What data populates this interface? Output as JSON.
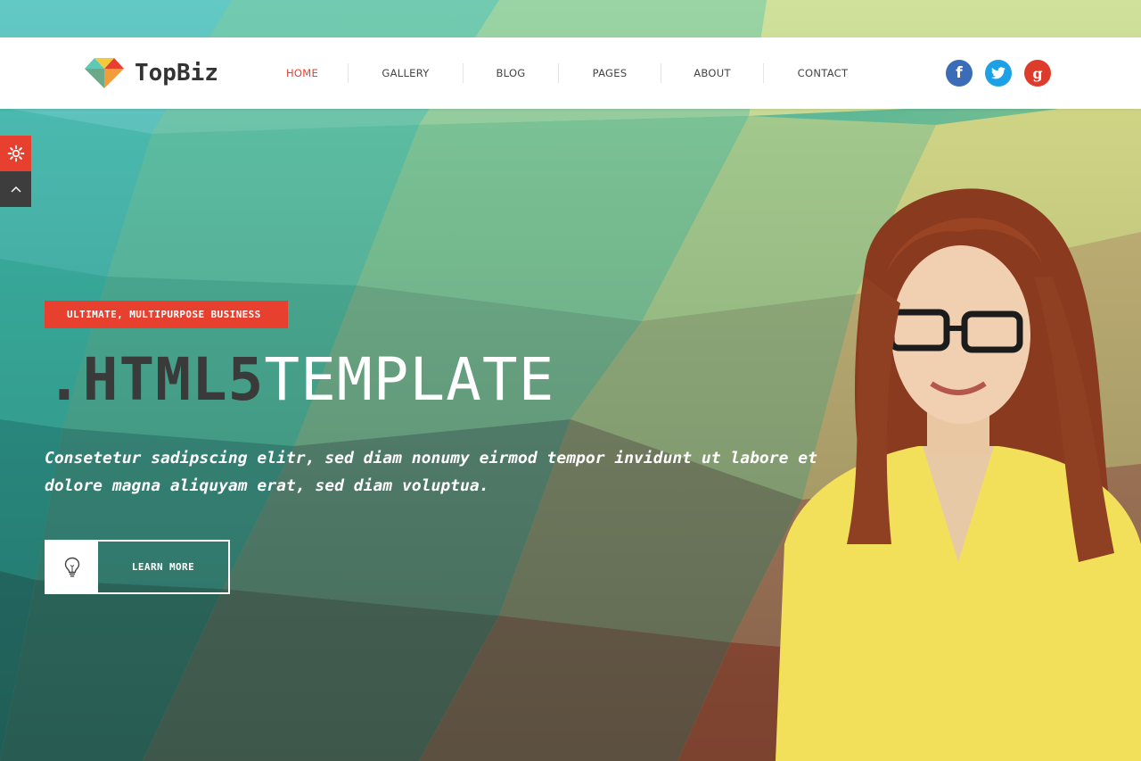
{
  "brand": {
    "name": "TopBiz",
    "logo_icon": "diamond-heart-logo-icon"
  },
  "nav": {
    "items": [
      {
        "label": "HOME",
        "active": true
      },
      {
        "label": "GALLERY",
        "active": false
      },
      {
        "label": "BLOG",
        "active": false
      },
      {
        "label": "PAGES",
        "active": false
      },
      {
        "label": "ABOUT",
        "active": false
      },
      {
        "label": "CONTACT",
        "active": false
      }
    ]
  },
  "social": {
    "facebook": {
      "glyph": "f",
      "color": "#3b6cb8",
      "icon": "facebook-icon"
    },
    "twitter": {
      "glyph": "t",
      "color": "#1da1e6",
      "icon": "twitter-bird-icon"
    },
    "google": {
      "glyph": "g",
      "color": "#dd3c2c",
      "icon": "google-plus-icon"
    }
  },
  "side_tools": {
    "settings_icon": "gear-icon",
    "scroll_top_icon": "chevron-up-icon"
  },
  "hero": {
    "tag": "ULTIMATE, MULTIPURPOSE BUSINESS",
    "headline_dark": ".HTML5",
    "headline_light": "TEMPLATE",
    "lead_line1": "Consetetur sadipscing elitr, sed diam nonumy eirmod tempor invidunt ut labore et",
    "lead_line2": "dolore magna aliquyam erat, sed diam voluptua.",
    "cta_label": "LEARN MORE",
    "cta_icon": "lightbulb-icon"
  },
  "colors": {
    "accent": "#e8402e",
    "nav_text": "#444444",
    "headline_dark": "#3a3a3a",
    "hero_teal": "#3fb9a8",
    "hero_yellow": "#d9e28a"
  }
}
